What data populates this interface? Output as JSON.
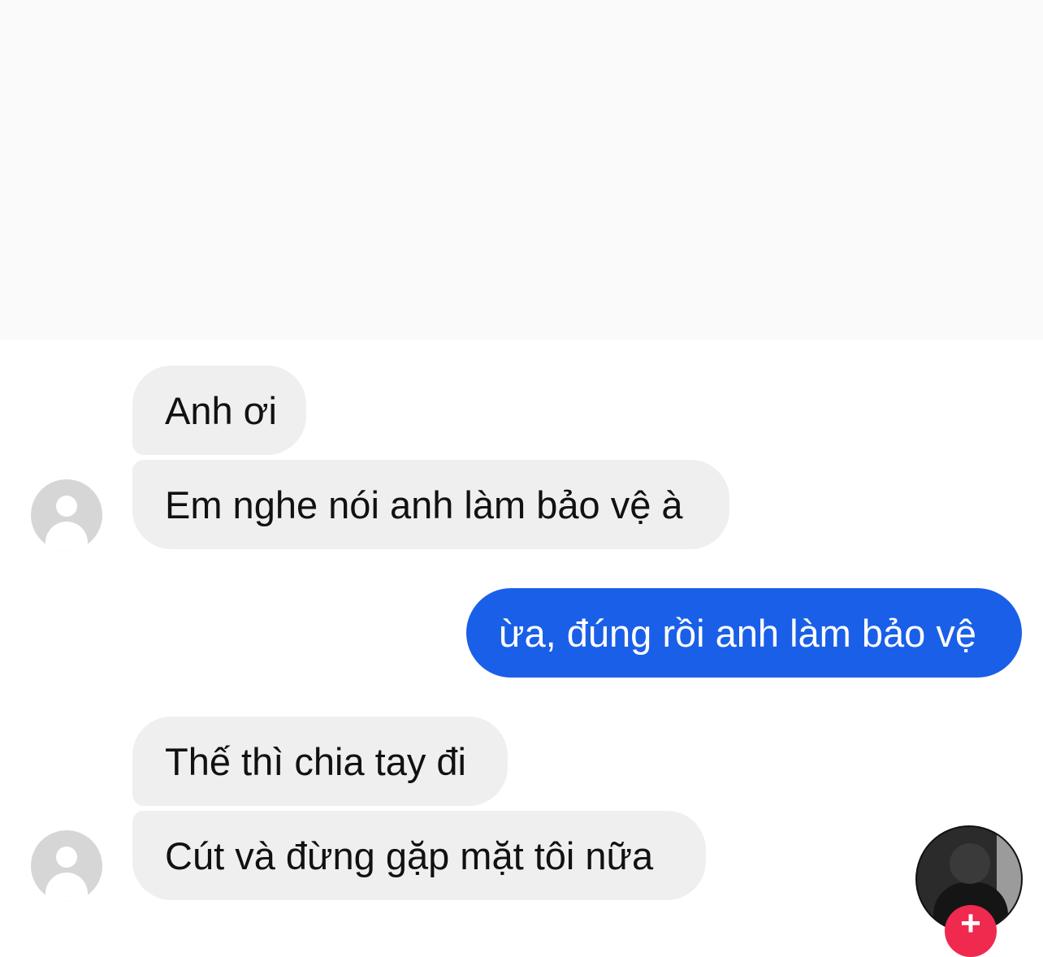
{
  "conversation": {
    "messages": [
      {
        "sender": "them",
        "text": "Anh ơi"
      },
      {
        "sender": "them",
        "text": "Em nghe nói anh làm bảo vệ à"
      },
      {
        "sender": "me",
        "text": "ừa, đúng rồi anh làm bảo vệ"
      },
      {
        "sender": "them",
        "text": "Thế thì chia tay đi"
      },
      {
        "sender": "them",
        "text": "Cút và đừng gặp mặt tôi nữa"
      }
    ]
  },
  "overlay": {
    "follow_icon": "plus-icon",
    "follow_label": "+"
  },
  "colors": {
    "incoming_bubble": "#efefef",
    "outgoing_bubble": "#1a5fe8",
    "follow_button": "#f0294f"
  }
}
